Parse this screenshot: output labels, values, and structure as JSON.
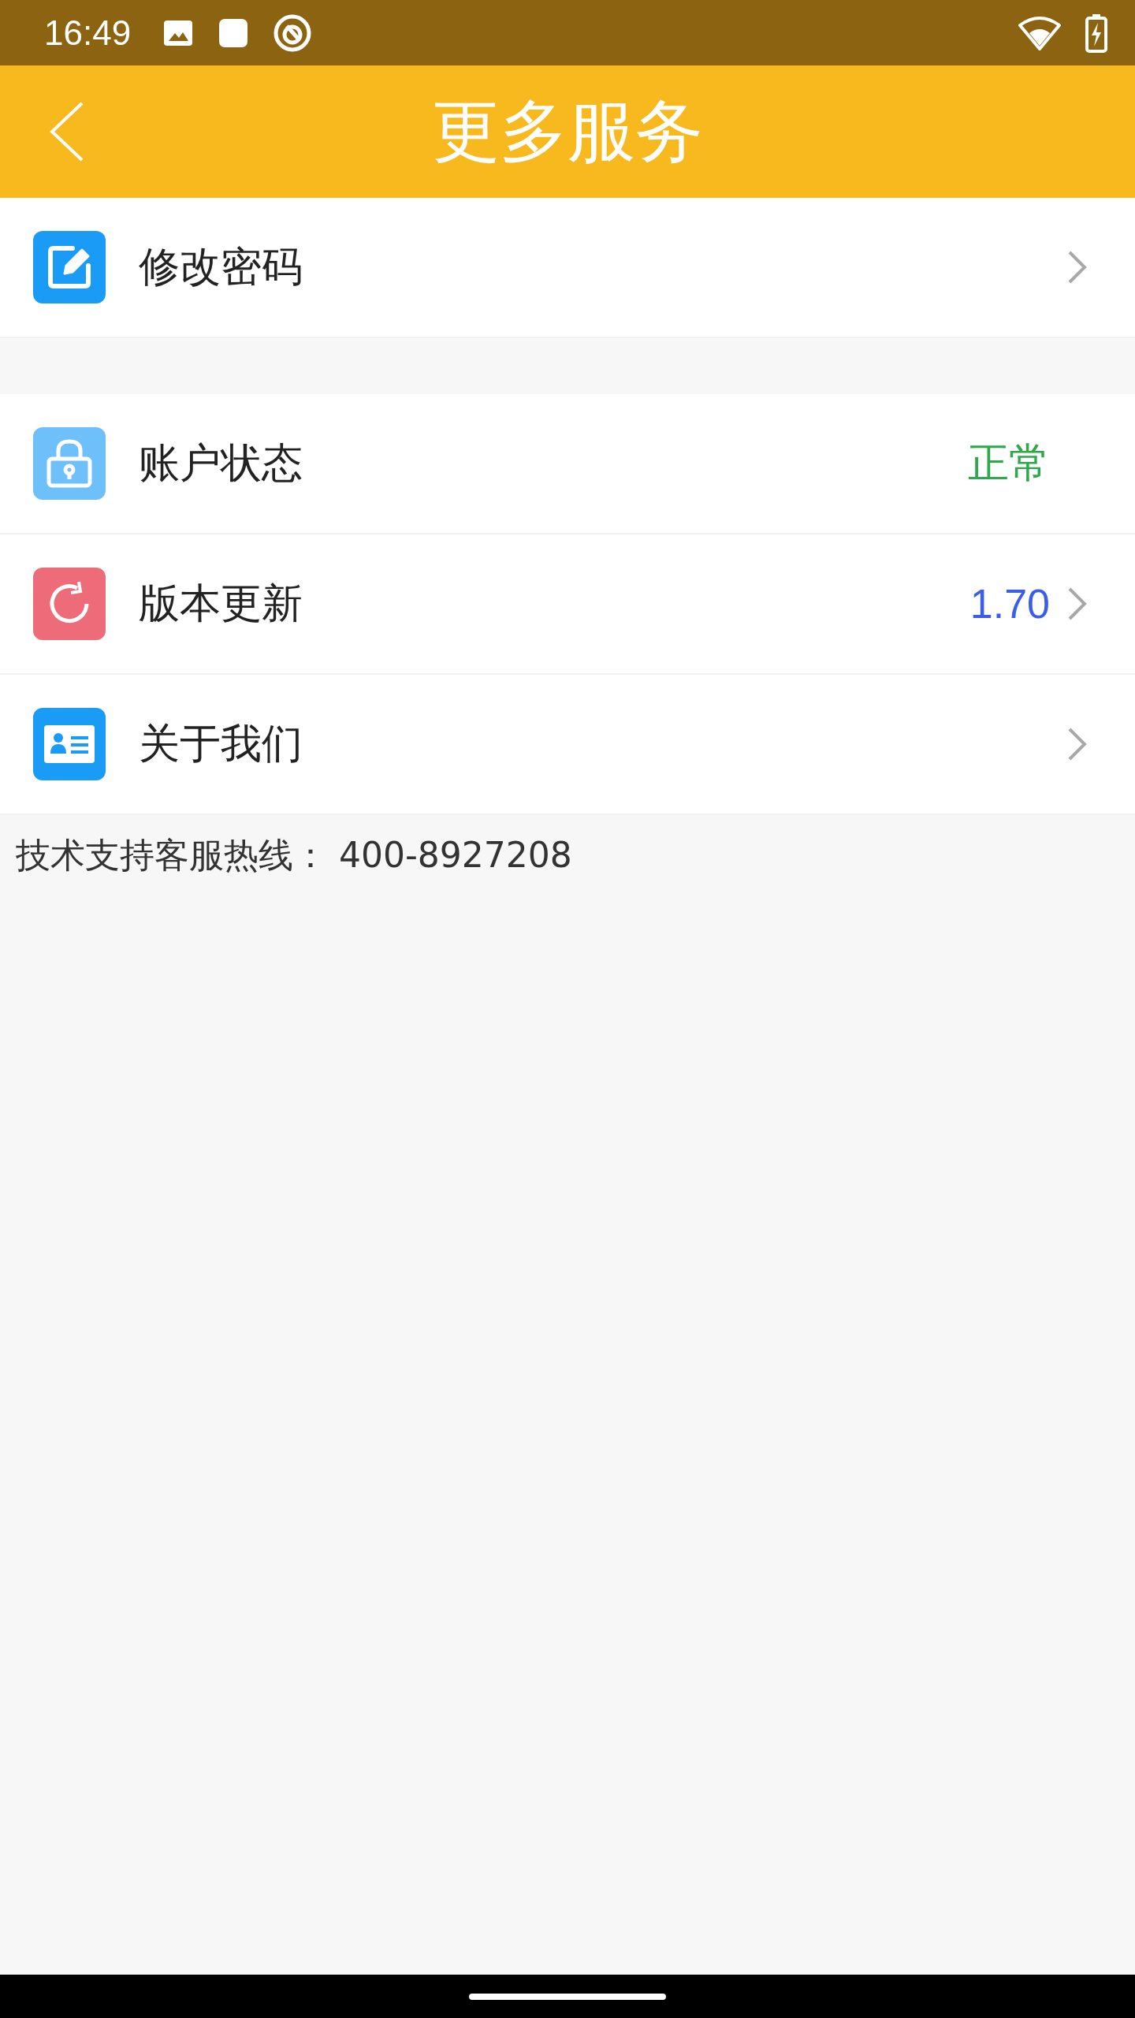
{
  "status_bar": {
    "time": "16:49"
  },
  "header": {
    "title": "更多服务"
  },
  "sections": [
    {
      "items": [
        {
          "kind": "edit",
          "label": "修改密码",
          "chevron": true
        }
      ]
    },
    {
      "items": [
        {
          "kind": "lock",
          "label": "账户状态",
          "value": "正常",
          "color": "#2ea84a",
          "chevron": false
        },
        {
          "kind": "refresh",
          "label": "版本更新",
          "value": "1.70",
          "color": "#3b5ee8",
          "chevron": true
        },
        {
          "kind": "card",
          "label": "关于我们",
          "chevron": true
        }
      ]
    }
  ],
  "footer": {
    "text": "技术支持客服热线： 400-8927208"
  }
}
